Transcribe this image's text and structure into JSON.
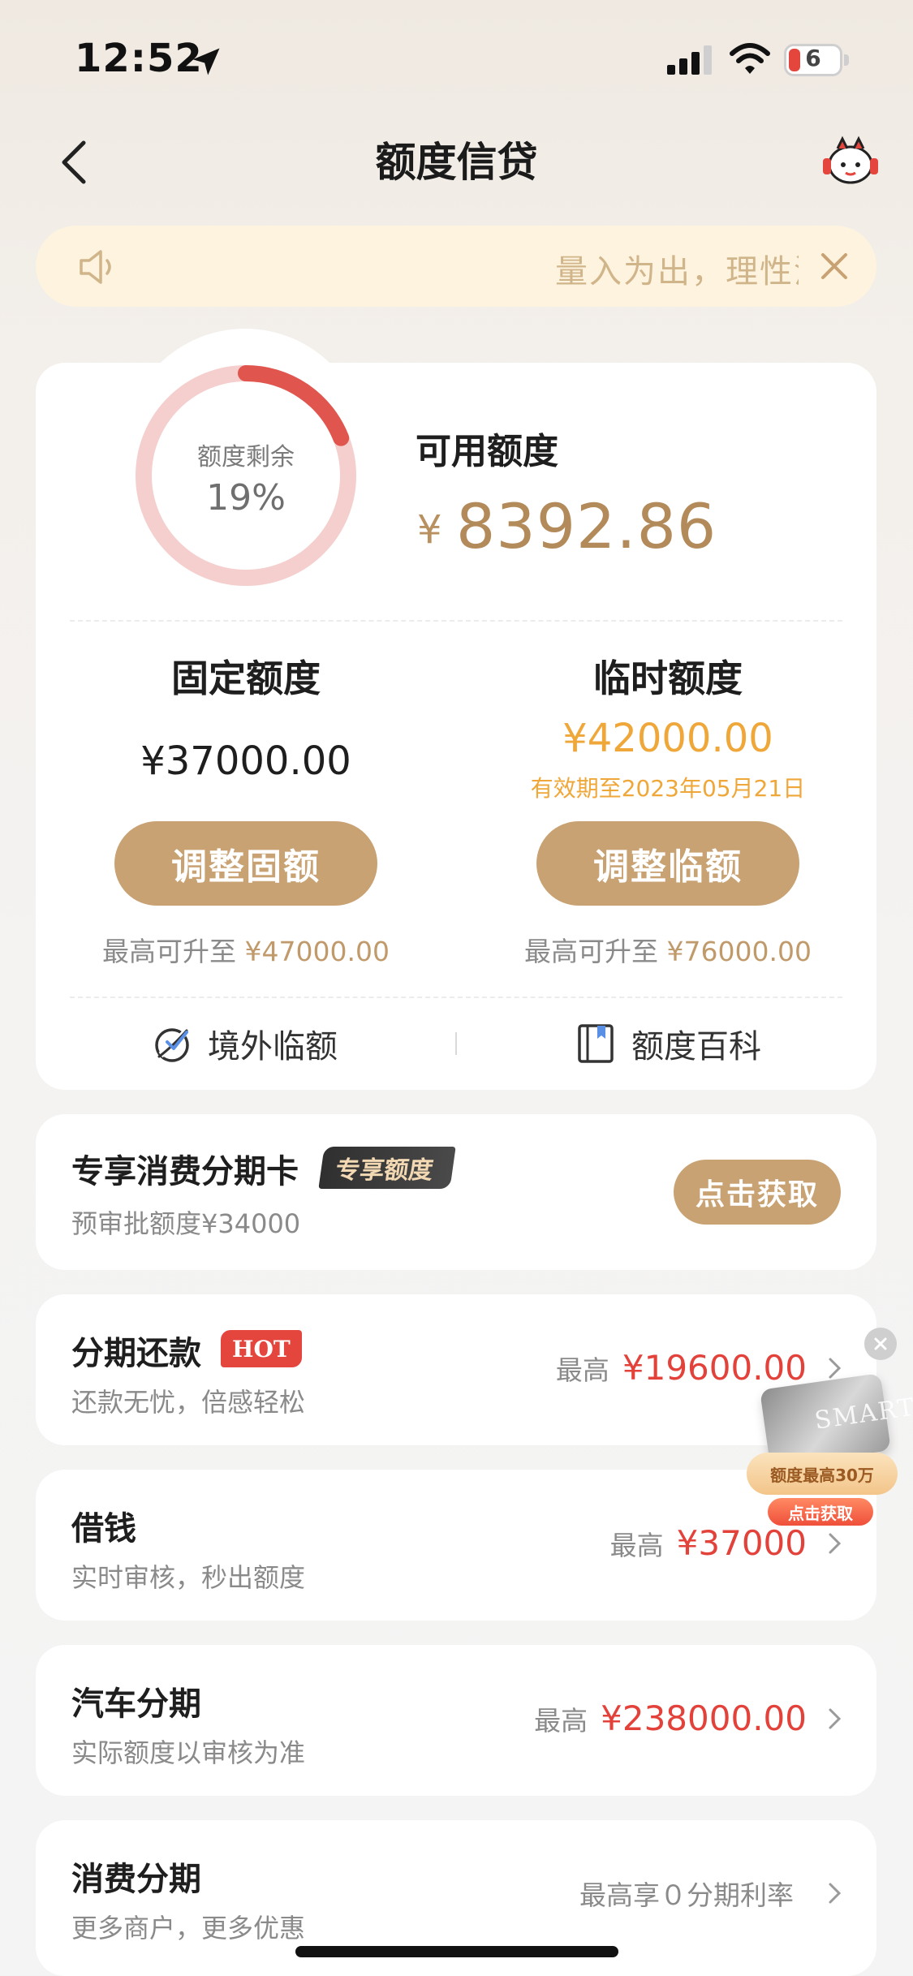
{
  "status_bar": {
    "time": "12:52",
    "battery_level": "6"
  },
  "nav": {
    "title": "额度信贷"
  },
  "notice": {
    "text": "量入为出，理性消费"
  },
  "credit": {
    "ring_label": "额度剩余",
    "ring_percent": "19%",
    "remaining_fraction": 0.19,
    "available_label": "可用额度",
    "currency_symbol": "¥",
    "available_amount": "8392.86",
    "fixed": {
      "title": "固定额度",
      "amount": "¥37000.00",
      "button": "调整固额",
      "max_prefix": "最高可升至",
      "max_amount": "¥47000.00"
    },
    "temporary": {
      "title": "临时额度",
      "amount": "¥42000.00",
      "expiry": "有效期至2023年05月21日",
      "button": "调整临额",
      "max_prefix": "最高可升至",
      "max_amount": "¥76000.00"
    },
    "links": {
      "overseas": "境外临额",
      "wiki": "额度百科"
    }
  },
  "exclusive_card": {
    "title": "专享消费分期卡",
    "badge": "专享额度",
    "subtitle": "预审批额度¥34000",
    "button": "点击获取"
  },
  "products": [
    {
      "title": "分期还款",
      "badge": "HOT",
      "subtitle": "还款无忧，倍感轻松",
      "prefix": "最高",
      "value": "¥19600.00"
    },
    {
      "title": "借钱",
      "subtitle": "实时审核，秒出额度",
      "prefix": "最高",
      "value": "¥37000"
    },
    {
      "title": "汽车分期",
      "subtitle": "实际额度以审核为准",
      "prefix": "最高",
      "value": "¥238000.00"
    },
    {
      "title": "消费分期",
      "subtitle": "更多商户，更多优惠",
      "prefix": "最高享０分期利率",
      "value": ""
    }
  ],
  "promo": {
    "card_text": "SMART",
    "ribbon": "额度最高30万",
    "button": "点击获取"
  },
  "colors": {
    "accent_gold": "#c9a273",
    "amount_orange": "#efa73a",
    "price_red": "#e3423b",
    "ring_red": "#e0554e",
    "ring_track": "#f4cfcd"
  }
}
